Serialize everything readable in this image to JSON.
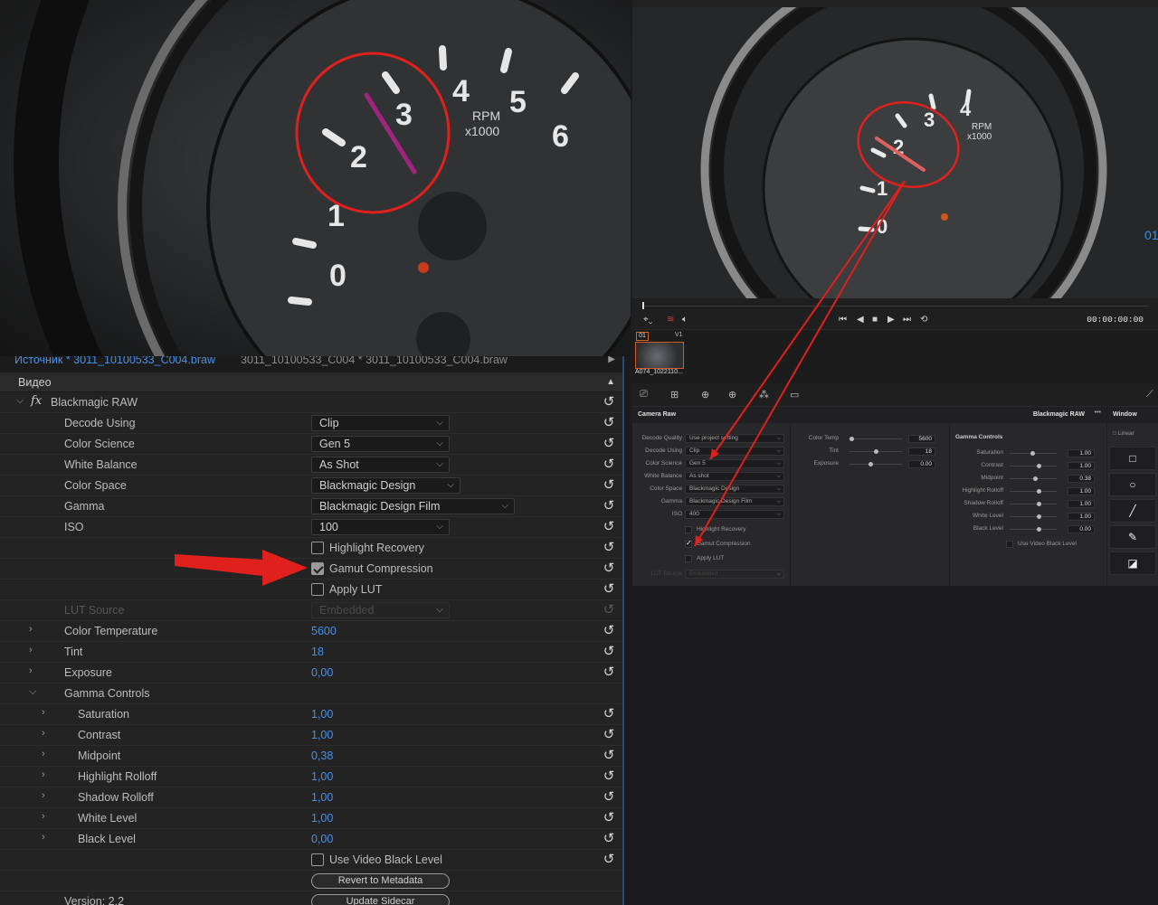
{
  "premiere": {
    "tabs": {
      "active": "Источник * 3011_10100533_C004.braw",
      "inactive": "3011_10100533_C004 * 3011_10100533_C004.braw"
    },
    "section": "Видео",
    "effect": {
      "fx": "fx",
      "name": "Blackmagic RAW"
    },
    "dropdowns": [
      {
        "label": "Decode Using",
        "value": "Clip"
      },
      {
        "label": "Color Science",
        "value": "Gen 5"
      },
      {
        "label": "White Balance",
        "value": "As Shot"
      },
      {
        "label": "Color Space",
        "value": "Blackmagic Design"
      },
      {
        "label": "Gamma",
        "value": "Blackmagic Design Film"
      },
      {
        "label": "ISO",
        "value": "100"
      }
    ],
    "checkboxes": [
      {
        "label": "Highlight Recovery",
        "checked": false
      },
      {
        "label": "Gamut Compression",
        "checked": true
      },
      {
        "label": "Apply LUT",
        "checked": false
      }
    ],
    "lut": {
      "label": "LUT Source",
      "value": "Embedded"
    },
    "params": [
      {
        "label": "Color Temperature",
        "value": "5600"
      },
      {
        "label": "Tint",
        "value": "18"
      },
      {
        "label": "Exposure",
        "value": "0,00"
      }
    ],
    "gamma_group": "Gamma Controls",
    "gamma": [
      {
        "label": "Saturation",
        "value": "1,00"
      },
      {
        "label": "Contrast",
        "value": "1,00"
      },
      {
        "label": "Midpoint",
        "value": "0,38"
      },
      {
        "label": "Highlight Rolloff",
        "value": "1,00"
      },
      {
        "label": "Shadow Rolloff",
        "value": "1,00"
      },
      {
        "label": "White Level",
        "value": "1,00"
      },
      {
        "label": "Black Level",
        "value": "0,00"
      }
    ],
    "video_black": "Use Video Black Level",
    "revert": "Revert to Metadata",
    "version": "Version: 2.2",
    "update": "Update Sidecar"
  },
  "gauge_left": {
    "numbers": [
      "0",
      "1",
      "2",
      "3",
      "4",
      "5",
      "6"
    ],
    "unit": "RPM",
    "mult": "x1000"
  },
  "gauge_right": {
    "numbers": [
      "0",
      "1",
      "2",
      "3",
      "4"
    ],
    "unit": "RPM",
    "mult": "x1000",
    "edge": [
      "01"
    ]
  },
  "resolve": {
    "timecode": "00:00:00:00",
    "clip": {
      "num": "01",
      "track": "V1",
      "name": "A074_1022110..."
    },
    "panel_title": "Camera Raw",
    "panel_subtitle": "Blackmagic RAW",
    "more": "•••",
    "col1": [
      {
        "label": "Decode Quality",
        "value": "Use project setting"
      },
      {
        "label": "Decode Using",
        "value": "Clip"
      },
      {
        "label": "Color Science",
        "value": "Gen 5"
      },
      {
        "label": "White Balance",
        "value": "As shot"
      },
      {
        "label": "Color Space",
        "value": "Blackmagic Design"
      },
      {
        "label": "Gamma",
        "value": "Blackmagic Design Film"
      },
      {
        "label": "ISO",
        "value": "400"
      }
    ],
    "col1_checks": [
      {
        "label": "Highlight Recovery",
        "checked": false
      },
      {
        "label": "Gamut Compression",
        "checked": true
      },
      {
        "label": "Apply LUT",
        "checked": false
      }
    ],
    "col1_lut": {
      "label": "LUT Source",
      "value": "Embedded"
    },
    "col2": [
      {
        "label": "Color Temp",
        "value": "5600",
        "pos": 0.05
      },
      {
        "label": "Tint",
        "value": "18",
        "pos": 0.5
      },
      {
        "label": "Exposure",
        "value": "0.00",
        "pos": 0.4
      }
    ],
    "col3_title": "Gamma Controls",
    "col3": [
      {
        "label": "Saturation",
        "value": "1.00",
        "pos": 0.3
      },
      {
        "label": "Contrast",
        "value": "1.00",
        "pos": 0.5
      },
      {
        "label": "Midpoint",
        "value": "0.38",
        "pos": 0.38
      },
      {
        "label": "Highlight Rolloff",
        "value": "1.00",
        "pos": 0.5
      },
      {
        "label": "Shadow Rolloff",
        "value": "1.00",
        "pos": 0.5
      },
      {
        "label": "White Level",
        "value": "1.00",
        "pos": 0.5
      },
      {
        "label": "Black Level",
        "value": "0.00",
        "pos": 0.5
      }
    ],
    "col3_check": "Use Video Black Level",
    "window": {
      "title": "Window",
      "linear": "Linear"
    }
  },
  "colors": {
    "accent": "#4a8fe3",
    "annotation": "#e0201c",
    "clip_border": "#cf5a2a"
  }
}
